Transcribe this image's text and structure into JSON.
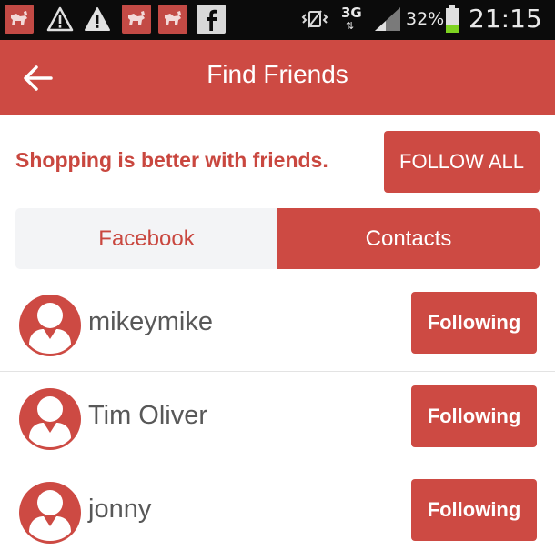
{
  "status_bar": {
    "notification_icons": [
      "dog-icon",
      "warning-icon",
      "warning-filled-icon",
      "dog-icon",
      "dog-icon",
      "facebook-icon"
    ],
    "network": "3G",
    "battery": "32%",
    "time": "21:15"
  },
  "app_bar": {
    "title": "Find Friends",
    "color": "#cd4a43"
  },
  "promo": {
    "text": "Shopping is better with friends.",
    "follow_all_label": "FOLLOW ALL"
  },
  "tabs": [
    {
      "label": "Facebook",
      "active": false
    },
    {
      "label": "Contacts",
      "active": true
    }
  ],
  "friends": [
    {
      "name": "mikeymike",
      "button": "Following"
    },
    {
      "name": "Tim Oliver",
      "button": "Following"
    },
    {
      "name": "jonny",
      "button": "Following"
    }
  ]
}
